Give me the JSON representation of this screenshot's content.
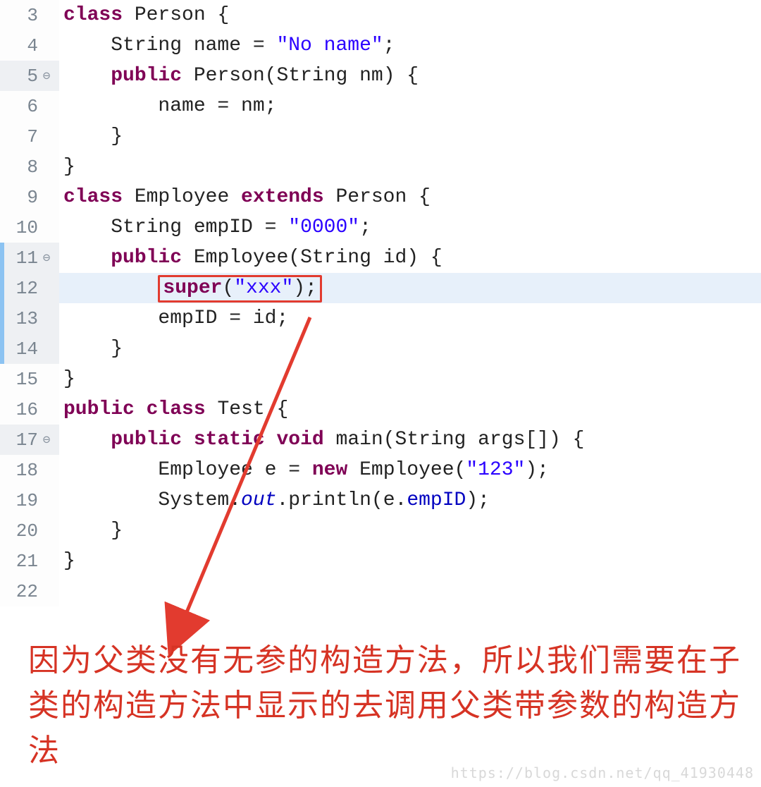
{
  "gutter": {
    "lines": [
      {
        "n": "3",
        "fold": "",
        "shaded": false,
        "mark": false
      },
      {
        "n": "4",
        "fold": "",
        "shaded": false,
        "mark": false
      },
      {
        "n": "5",
        "fold": "⊖",
        "shaded": true,
        "mark": false
      },
      {
        "n": "6",
        "fold": "",
        "shaded": false,
        "mark": false
      },
      {
        "n": "7",
        "fold": "",
        "shaded": false,
        "mark": false
      },
      {
        "n": "8",
        "fold": "",
        "shaded": false,
        "mark": false
      },
      {
        "n": "9",
        "fold": "",
        "shaded": false,
        "mark": false
      },
      {
        "n": "10",
        "fold": "",
        "shaded": false,
        "mark": false
      },
      {
        "n": "11",
        "fold": "⊖",
        "shaded": true,
        "mark": true
      },
      {
        "n": "12",
        "fold": "",
        "shaded": true,
        "mark": true
      },
      {
        "n": "13",
        "fold": "",
        "shaded": true,
        "mark": true
      },
      {
        "n": "14",
        "fold": "",
        "shaded": true,
        "mark": true
      },
      {
        "n": "15",
        "fold": "",
        "shaded": false,
        "mark": false
      },
      {
        "n": "16",
        "fold": "",
        "shaded": false,
        "mark": false
      },
      {
        "n": "17",
        "fold": "⊖",
        "shaded": true,
        "mark": false
      },
      {
        "n": "18",
        "fold": "",
        "shaded": false,
        "mark": false
      },
      {
        "n": "19",
        "fold": "",
        "shaded": false,
        "mark": false
      },
      {
        "n": "20",
        "fold": "",
        "shaded": false,
        "mark": false
      },
      {
        "n": "21",
        "fold": "",
        "shaded": false,
        "mark": false
      },
      {
        "n": "22",
        "fold": "",
        "shaded": false,
        "mark": false
      }
    ]
  },
  "code": {
    "l3": {
      "kw1": "class",
      "t1": " Person {"
    },
    "l4": {
      "t1": "    String name = ",
      "s1": "\"No name\"",
      "t2": ";"
    },
    "l5": {
      "kw1": "public",
      "t1": " Person(String nm) {",
      "indent": "    "
    },
    "l6": {
      "t1": "        name = nm;"
    },
    "l7": {
      "t1": "    }"
    },
    "l8": {
      "t1": "}"
    },
    "l9": {
      "kw1": "class",
      "t1": " Employee ",
      "kw2": "extends",
      "t2": " Person {"
    },
    "l10": {
      "t1": "    String empID = ",
      "s1": "\"0000\"",
      "t2": ";"
    },
    "l11": {
      "indent": "    ",
      "kw1": "public",
      "t1": " Employee(String id) {"
    },
    "l12": {
      "indent": "        ",
      "kw1": "super",
      "p1": "(",
      "s1": "\"xxx\"",
      "p2": ");"
    },
    "l13": {
      "t1": "        empID = id;"
    },
    "l14": {
      "t1": "    }"
    },
    "l15": {
      "t1": "}"
    },
    "l16": {
      "kw1": "public",
      "kw2": "class",
      "t1": " Test {"
    },
    "l17": {
      "indent": "    ",
      "kw1": "public",
      "kw2": "static",
      "kw3": "void",
      "t1": " main(String args[]) {"
    },
    "l18": {
      "t1": "        Employee e = ",
      "kw1": "new",
      "t2": " Employee(",
      "s1": "\"123\"",
      "t3": ");"
    },
    "l19": {
      "t1": "        System.",
      "it1": "out",
      "t2": ".println(e.",
      "f1": "empID",
      "t3": ");"
    },
    "l20": {
      "t1": "    }"
    },
    "l21": {
      "t1": "}"
    },
    "l22": {
      "t1": ""
    }
  },
  "annotation": {
    "text": "因为父类没有无参的构造方法，所以我们需要在子类的构造方法中显示的去调用父类带参数的构造方法"
  },
  "watermark": {
    "text": "https://blog.csdn.net/qq_41930448"
  }
}
